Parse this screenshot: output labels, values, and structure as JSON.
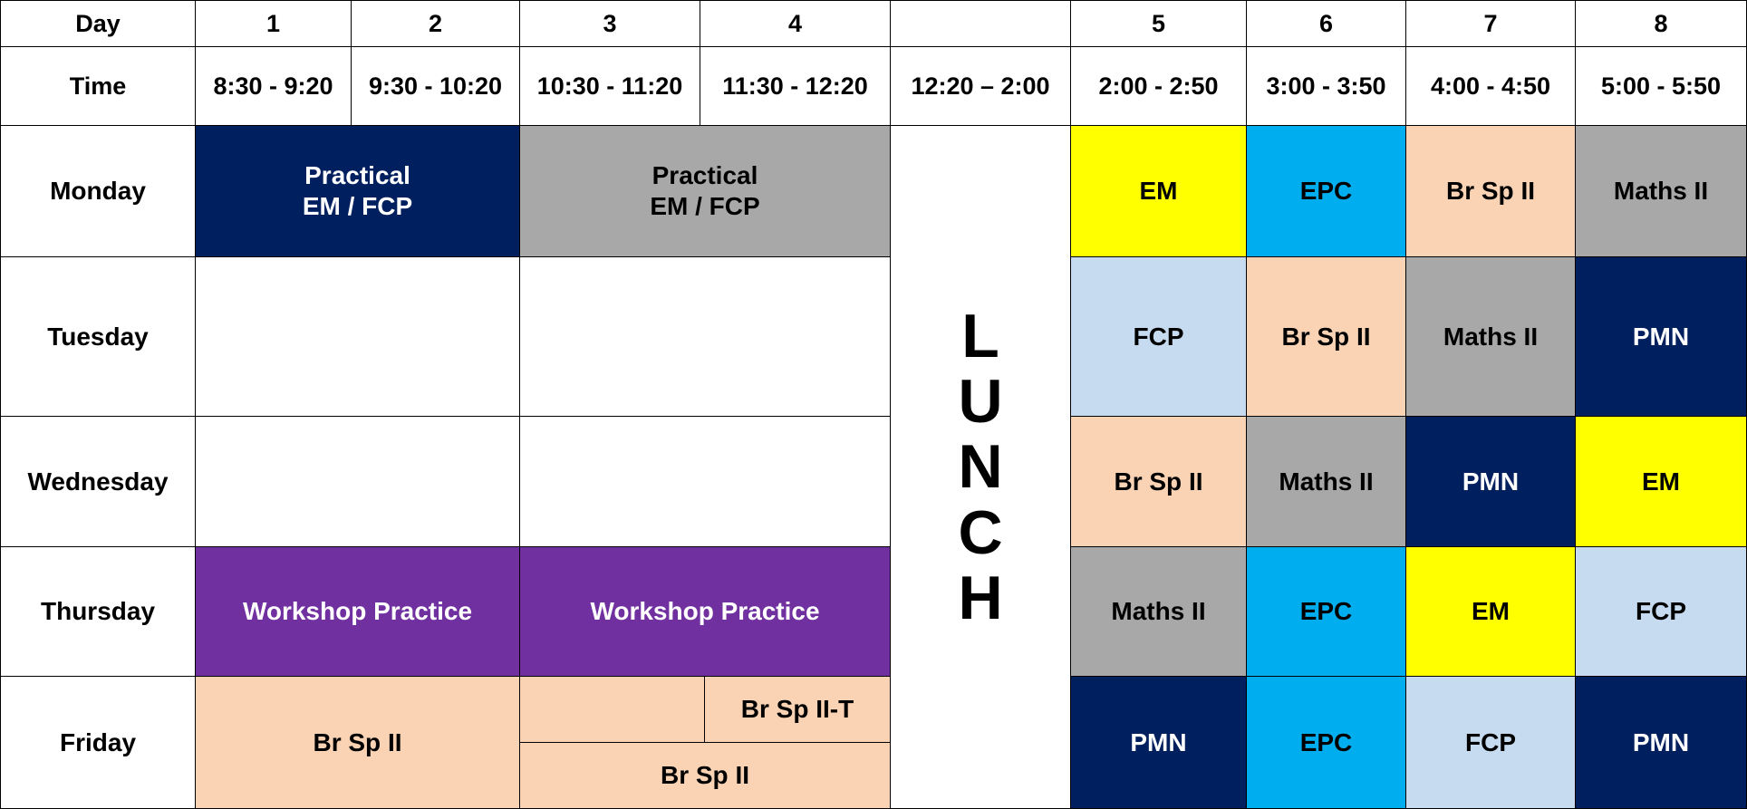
{
  "header": {
    "day_label": "Day",
    "time_label": "Time",
    "periods": [
      {
        "day": "1",
        "time": "8:30 - 9:20"
      },
      {
        "day": "2",
        "time": "9:30 - 10:20"
      },
      {
        "day": "3",
        "time": "10:30 - 11:20"
      },
      {
        "day": "4",
        "time": "11:30 - 12:20"
      },
      {
        "day": "",
        "time": "12:20 – 2:00"
      },
      {
        "day": "5",
        "time": "2:00 - 2:50"
      },
      {
        "day": "6",
        "time": "3:00 - 3:50"
      },
      {
        "day": "7",
        "time": "4:00 - 4:50"
      },
      {
        "day": "8",
        "time": "5:00 - 5:50"
      }
    ]
  },
  "days": [
    "Monday",
    "Tuesday",
    "Wednesday",
    "Thursday",
    "Friday"
  ],
  "lunch": {
    "text": "L\nU\nN\nC\nH"
  },
  "morning": {
    "monday_1": "Practical\nEM / FCP",
    "monday_2": "Practical\nEM / FCP",
    "thursday_1": "Workshop Practice",
    "thursday_2": "Workshop Practice",
    "friday_1": "Br Sp II",
    "friday_tutorial": "Br Sp II-T",
    "friday_2": "Br Sp II"
  },
  "afternoon": {
    "monday": [
      "EM",
      "EPC",
      "Br Sp II",
      "Maths II"
    ],
    "tuesday": [
      "FCP",
      "Br Sp II",
      "Maths II",
      "PMN"
    ],
    "wednesday": [
      "Br Sp II",
      "Maths II",
      "PMN",
      "EM"
    ],
    "thursday": [
      "Maths II",
      "EPC",
      "EM",
      "FCP"
    ],
    "friday": [
      "PMN",
      "EPC",
      "FCP",
      "PMN"
    ]
  },
  "colors": {
    "navy": "#001f5e",
    "grey": "#a9a8a9",
    "yellow": "#ffff00",
    "cyan": "#00aeef",
    "peach": "#fad3b5",
    "light_blue": "#c6daf0",
    "purple": "#7030a0"
  }
}
